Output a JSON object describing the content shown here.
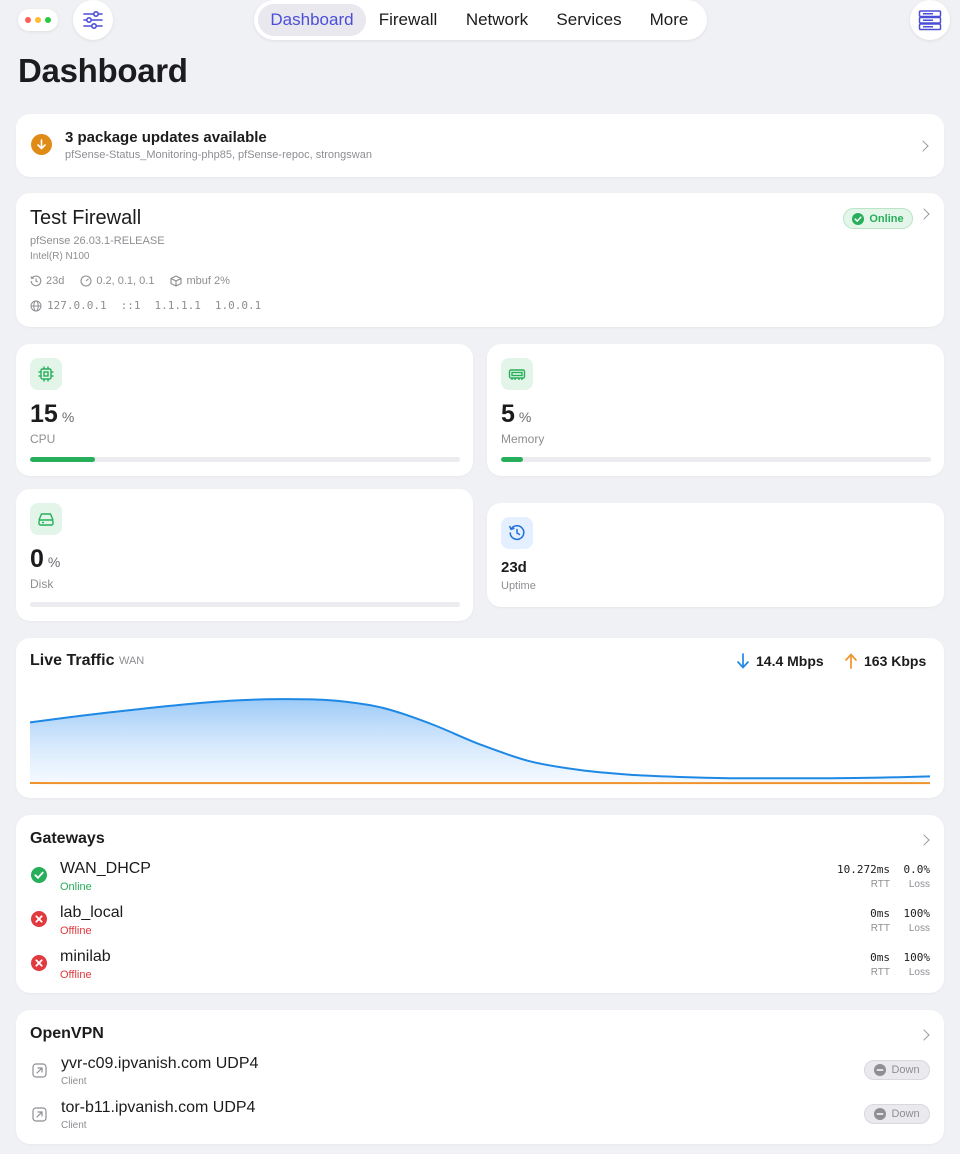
{
  "nav": {
    "tabs": [
      {
        "label": "Dashboard",
        "active": true
      },
      {
        "label": "Firewall",
        "active": false
      },
      {
        "label": "Network",
        "active": false
      },
      {
        "label": "Services",
        "active": false
      },
      {
        "label": "More",
        "active": false
      }
    ]
  },
  "page": {
    "title": "Dashboard"
  },
  "updates": {
    "title": "3 package updates available",
    "packages": "pfSense-Status_Monitoring-php85, pfSense-repoc, strongswan"
  },
  "firewall": {
    "name": "Test Firewall",
    "version": "pfSense 26.03.1-RELEASE",
    "cpu_model": "Intel(R) N100",
    "status": "Online",
    "uptime": "23d",
    "load": "0.2, 0.1, 0.1",
    "mbuf": "mbuf 2%",
    "ips": [
      "127.0.0.1",
      "::1",
      "1.1.1.1",
      "1.0.0.1"
    ]
  },
  "stats": {
    "cpu": {
      "value": "15",
      "unit": "%",
      "label": "CPU",
      "percent": 15
    },
    "memory": {
      "value": "5",
      "unit": "%",
      "label": "Memory",
      "percent": 5
    },
    "disk": {
      "value": "0",
      "unit": "%",
      "label": "Disk",
      "percent": 0
    },
    "uptime": {
      "value": "23d",
      "label": "Uptime"
    }
  },
  "traffic": {
    "title": "Live Traffic",
    "interface": "WAN",
    "download": "14.4 Mbps",
    "upload": "163 Kbps"
  },
  "chart_data": {
    "type": "area",
    "title": "Live Traffic",
    "series": [
      {
        "name": "download",
        "color": "#1e88e5",
        "values": [
          10.6,
          11.7,
          12.7,
          13.6,
          14.3,
          14.6,
          14.4,
          13.2,
          10.4,
          6.8,
          3.9,
          2.4,
          1.6,
          1.2,
          1.0,
          1.0,
          1.0,
          1.1,
          1.3
        ]
      },
      {
        "name": "upload",
        "color": "#f0922b",
        "values": [
          0.163,
          0.163,
          0.163,
          0.163,
          0.163,
          0.163,
          0.163,
          0.163,
          0.163,
          0.163,
          0.163,
          0.163,
          0.163,
          0.163,
          0.163,
          0.163,
          0.163,
          0.163,
          0.163
        ]
      }
    ],
    "ylim": [
      0,
      16.5
    ]
  },
  "gateways": {
    "title": "Gateways",
    "rtt_label": "RTT",
    "loss_label": "Loss",
    "items": [
      {
        "name": "WAN_DHCP",
        "status": "Online",
        "rtt": "10.272ms",
        "loss": "0.0%",
        "ok": true
      },
      {
        "name": "lab_local",
        "status": "Offline",
        "rtt": "0ms",
        "loss": "100%",
        "ok": false
      },
      {
        "name": "minilab",
        "status": "Offline",
        "rtt": "0ms",
        "loss": "100%",
        "ok": false
      }
    ]
  },
  "openvpn": {
    "title": "OpenVPN",
    "items": [
      {
        "name": "yvr-c09.ipvanish.com UDP4",
        "role": "Client",
        "status": "Down"
      },
      {
        "name": "tor-b11.ipvanish.com UDP4",
        "role": "Client",
        "status": "Down"
      }
    ]
  },
  "colors": {
    "accent": "#4b4fd6",
    "success": "#27ae5a",
    "danger": "#e0393e",
    "warning": "#e08a17",
    "download": "#1e88e5",
    "upload": "#f0922b"
  }
}
